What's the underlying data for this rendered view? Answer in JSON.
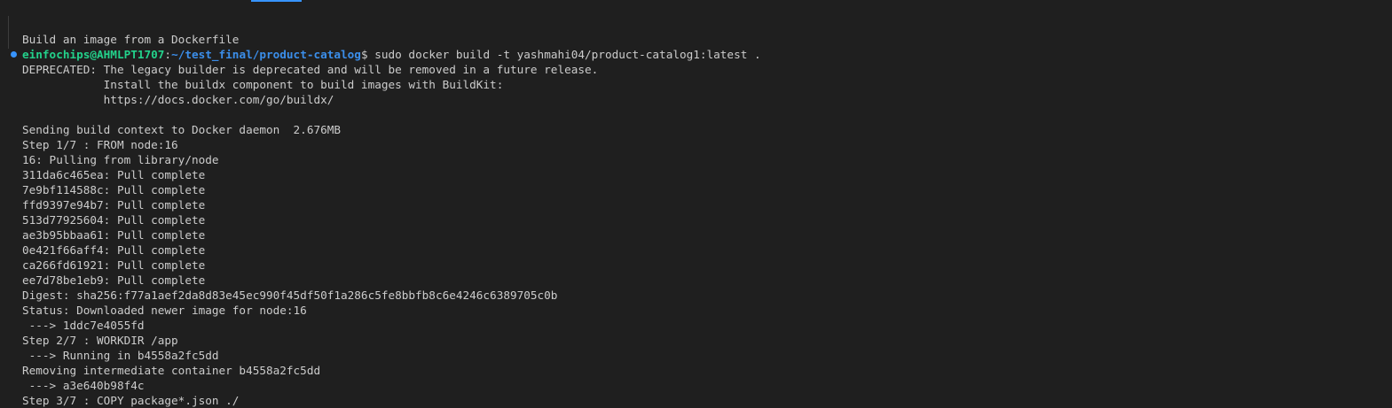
{
  "terminal": {
    "prompt": {
      "user_host": "einfochips@AHMLPT1707",
      "separator": ":",
      "path": "~/test_final/product-catalog",
      "symbol": "$",
      "command": " sudo docker build -t yashmahi04/product-catalog1:latest ."
    },
    "output_before_prompt": [
      "Build an image from a Dockerfile"
    ],
    "output_lines": [
      "DEPRECATED: The legacy builder is deprecated and will be removed in a future release.",
      "            Install the buildx component to build images with BuildKit:",
      "            https://docs.docker.com/go/buildx/",
      "",
      "Sending build context to Docker daemon  2.676MB",
      "Step 1/7 : FROM node:16",
      "16: Pulling from library/node",
      "311da6c465ea: Pull complete",
      "7e9bf114588c: Pull complete",
      "ffd9397e94b7: Pull complete",
      "513d77925604: Pull complete",
      "ae3b95bbaa61: Pull complete",
      "0e421f66aff4: Pull complete",
      "ca266fd61921: Pull complete",
      "ee7d78be1eb9: Pull complete",
      "Digest: sha256:f77a1aef2da8d83e45ec990f45df50f1a286c5fe8bbfb8c6e4246c6389705c0b",
      "Status: Downloaded newer image for node:16",
      " ---> 1ddc7e4055fd",
      "Step 2/7 : WORKDIR /app",
      " ---> Running in b4558a2fc5dd",
      "Removing intermediate container b4558a2fc5dd",
      " ---> a3e640b98f4c",
      "Step 3/7 : COPY package*.json ./"
    ]
  }
}
